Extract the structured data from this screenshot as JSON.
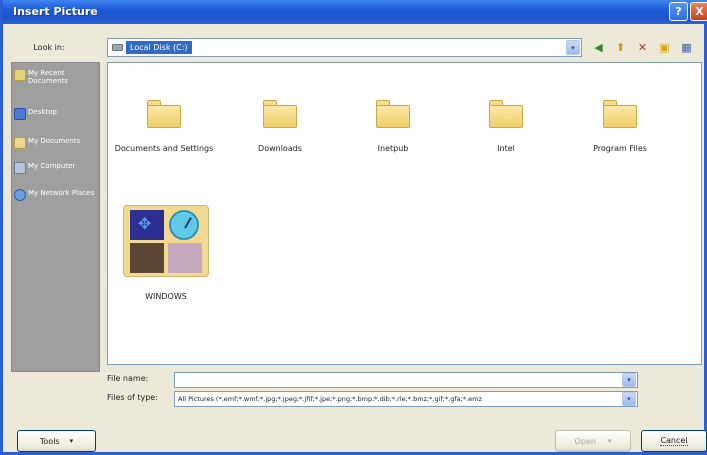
{
  "window": {
    "title": "Insert Picture",
    "help_label": "?",
    "close_label": "X"
  },
  "look_in": {
    "label": "Look in:",
    "value": "Local Disk (C:)",
    "arrow": "▾"
  },
  "toolbar": {
    "back": "◀",
    "up": "⬆",
    "delete": "✕",
    "new_folder": "▣",
    "views": "▦"
  },
  "places": [
    {
      "label": "My Recent Documents",
      "icon": "recent-documents-icon"
    },
    {
      "label": "Desktop",
      "icon": "desktop-icon"
    },
    {
      "label": "My Documents",
      "icon": "my-documents-icon"
    },
    {
      "label": "My Computer",
      "icon": "computer-icon"
    },
    {
      "label": "My Network Places",
      "icon": "network-places-icon"
    }
  ],
  "folders": [
    {
      "name": "Documents and Settings"
    },
    {
      "name": "Downloads"
    },
    {
      "name": "Inetpub"
    },
    {
      "name": "Intel"
    },
    {
      "name": "Program Files"
    },
    {
      "name": "WINDOWS"
    }
  ],
  "file_name": {
    "label": "File name:",
    "value": ""
  },
  "files_of_type": {
    "label": "Files of type:",
    "value": "All Pictures (*.emf;*.wmf;*.jpg;*.jpeg;*.jfif;*.jpe;*.png;*.bmp;*.dib;*.rle;*.bmz;*.gif;*.gfa;*.emz"
  },
  "buttons": {
    "tools": "Tools",
    "open": "Open",
    "cancel": "Cancel",
    "dropdown_arrow": "▾"
  }
}
